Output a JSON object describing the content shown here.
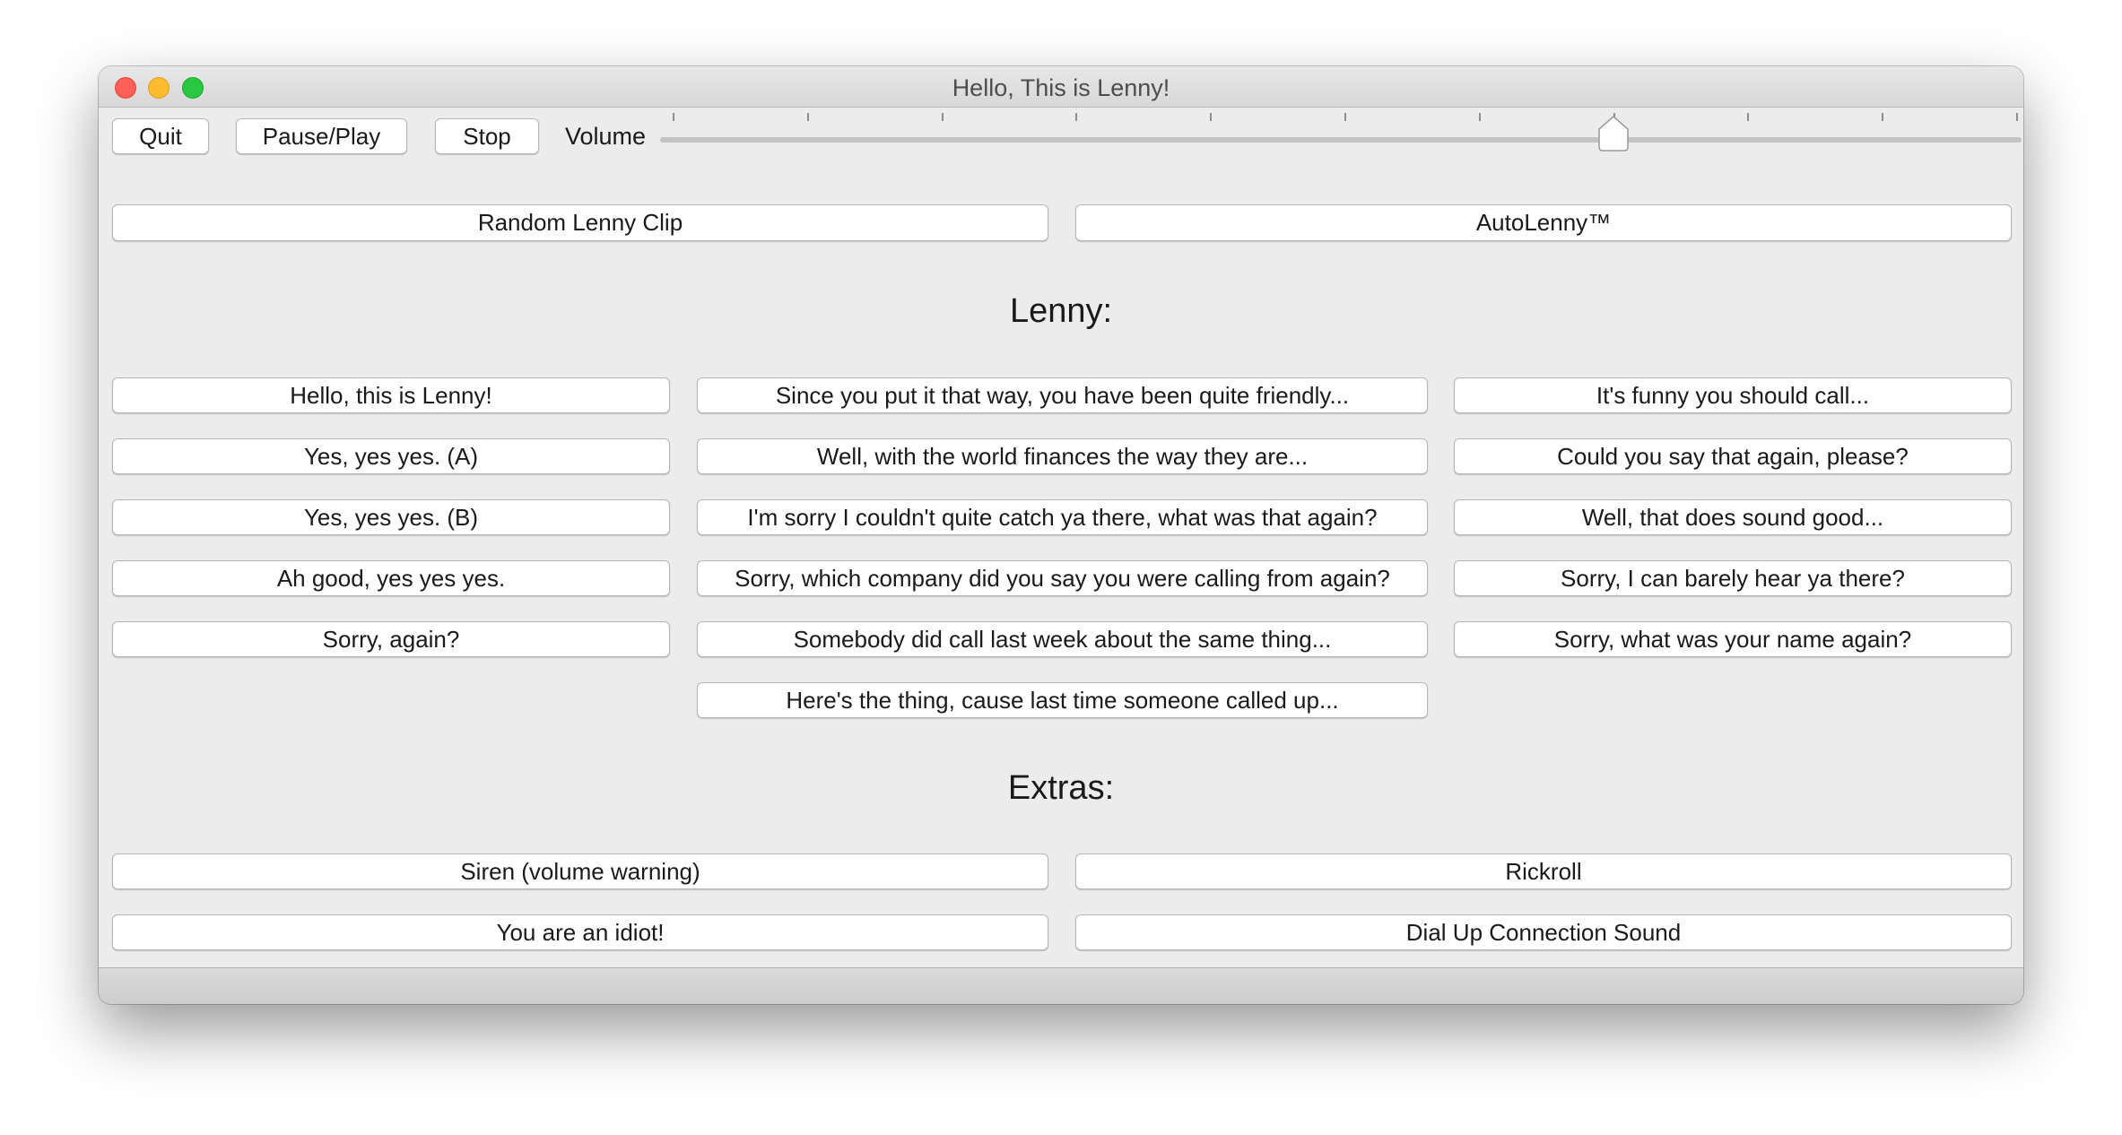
{
  "window": {
    "title": "Hello, This is Lenny!"
  },
  "toolbar": {
    "quit": "Quit",
    "pause_play": "Pause/Play",
    "stop": "Stop",
    "volume_label": "Volume",
    "volume_level": 0.7
  },
  "top_buttons": {
    "random": "Random Lenny Clip",
    "auto": "AutoLenny™"
  },
  "lenny": {
    "heading": "Lenny:",
    "col1": [
      "Hello, this is Lenny!",
      "Yes, yes yes. (A)",
      "Yes, yes yes. (B)",
      "Ah good, yes yes yes.",
      "Sorry, again?"
    ],
    "col2": [
      "Since you put it that way, you have been quite friendly...",
      "Well, with the world finances the way they are...",
      "I'm sorry I couldn't quite catch ya there, what was that again?",
      "Sorry, which company did you say you were calling from again?",
      "Somebody did call last week about the same thing...",
      "Here's the thing, cause last time someone called up..."
    ],
    "col3": [
      "It's funny you should call...",
      "Could you say that again, please?",
      "Well, that does sound good...",
      "Sorry, I can barely hear ya there?",
      "Sorry, what was your name again?"
    ]
  },
  "extras": {
    "heading": "Extras:",
    "siren": "Siren (volume warning)",
    "rickroll": "Rickroll",
    "idiot": "You are an idiot!",
    "dialup": "Dial Up Connection Sound"
  }
}
